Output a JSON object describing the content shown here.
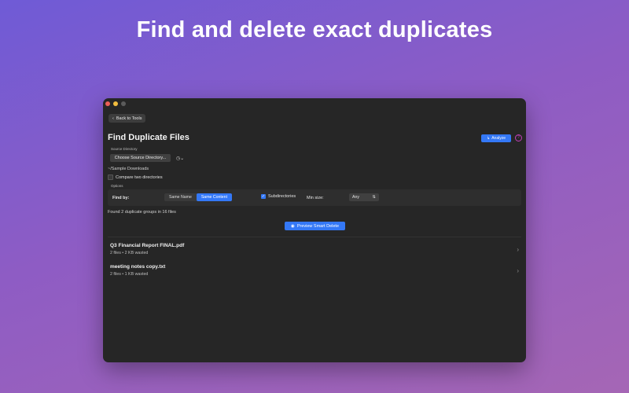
{
  "headline": "Find and delete exact duplicates",
  "toolbar": {
    "back_label": "Back to Tools"
  },
  "page": {
    "title": "Find Duplicate Files",
    "analyze_label": "Analyze",
    "help_symbol": "?"
  },
  "source": {
    "label": "Source Directory",
    "choose_label": "Choose Source Directory...",
    "path": "~/Sample Downloads",
    "compare_label": "Compare two directories"
  },
  "options": {
    "label": "Options",
    "find_by_label": "Find by:",
    "find_by_options": [
      "Same Name",
      "Same Content"
    ],
    "find_by_selected": "Same Content",
    "subdirectories_label": "Subdirectories",
    "min_size_label": "Min size:",
    "min_size_value": "Any"
  },
  "results": {
    "summary": "Found 2 duplicate groups in 16 files",
    "preview_label": "Preview Smart Delete",
    "groups": [
      {
        "name": "Q3 Financial Report FINAL.pdf",
        "detail": "2 files • 2 KB wasted"
      },
      {
        "name": "meeting notes copy.txt",
        "detail": "2 files • 1 KB wasted"
      }
    ]
  },
  "colors": {
    "accent": "#3478f6",
    "help": "#c23fb8",
    "window_bg": "#262626"
  }
}
